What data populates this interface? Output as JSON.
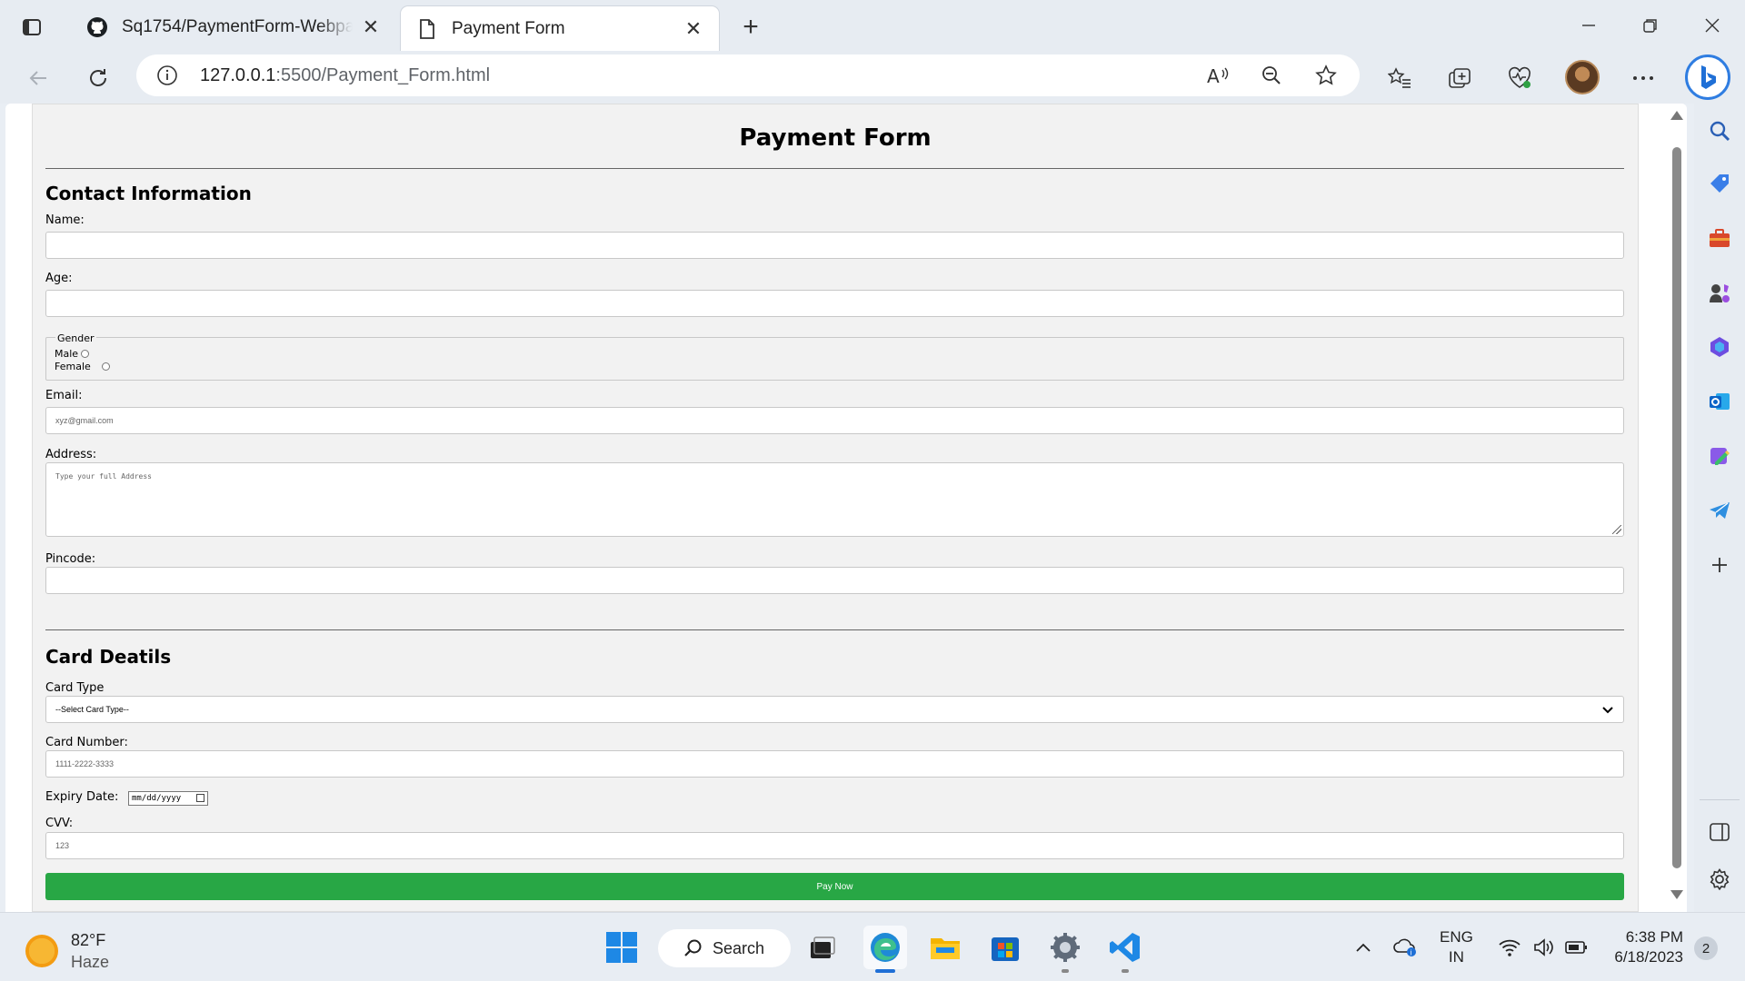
{
  "browser": {
    "tabs": [
      {
        "title": "Sq1754/PaymentForm-Webpage",
        "icon": "github-icon",
        "active": false
      },
      {
        "title": "Payment Form",
        "icon": "page-icon",
        "active": true
      }
    ],
    "url_host": "127.0.0.1",
    "url_path": ":5500/Payment_Form.html"
  },
  "form": {
    "title": "Payment Form",
    "contact_heading": "Contact Information",
    "name_label": "Name:",
    "age_label": "Age:",
    "gender_legend": "Gender",
    "gender_options": [
      "Male",
      "Female"
    ],
    "email_label": "Email:",
    "email_placeholder": "xyz@gmail.com",
    "address_label": "Address:",
    "address_placeholder": "Type your full Address",
    "pincode_label": "Pincode:",
    "card_heading": "Card Deatils",
    "card_type_label": "Card Type",
    "card_type_selected": "--Select Card Type--",
    "card_number_label": "Card Number:",
    "card_number_placeholder": "1111-2222-3333",
    "expiry_label": "Expiry Date:",
    "expiry_placeholder": "mm/dd/yyyy",
    "cvv_label": "CVV:",
    "cvv_placeholder": "123",
    "pay_button": "Pay Now",
    "pay_button_color": "#28a745"
  },
  "taskbar": {
    "weather_temp": "82°F",
    "weather_condition": "Haze",
    "search_label": "Search",
    "lang_line1": "ENG",
    "lang_line2": "IN",
    "time": "6:38 PM",
    "date": "6/18/2023",
    "notification_count": "2"
  }
}
